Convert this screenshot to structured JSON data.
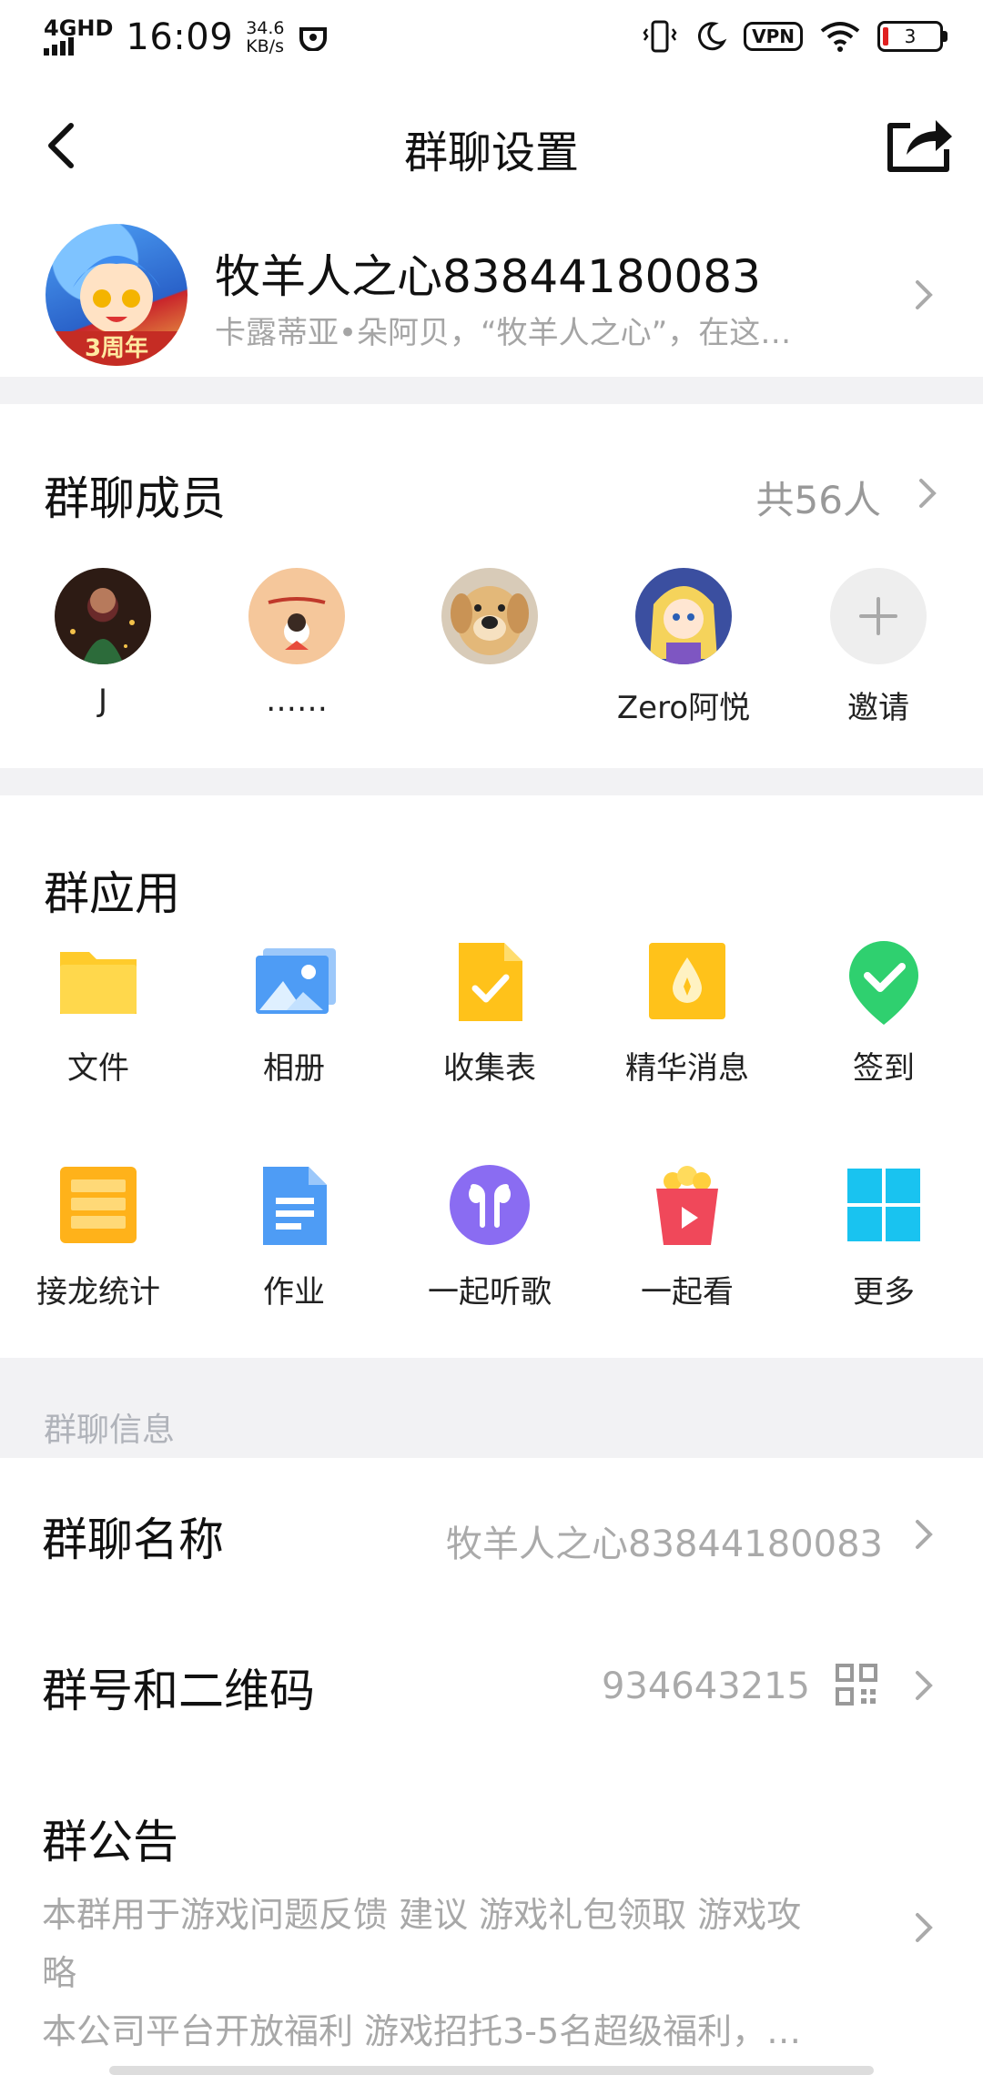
{
  "status_bar": {
    "network": "4GHD",
    "time": "16:09",
    "speed_value": "34.6",
    "speed_unit": "KB/s",
    "vpn": "VPN",
    "battery": "3"
  },
  "nav": {
    "title": "群聊设置",
    "back_icon": "chevron-left-icon",
    "share_icon": "share-icon"
  },
  "group": {
    "avatar_badge": "3周年",
    "name": "牧羊人之心83844180083",
    "description": "卡露蒂亚•朵阿贝，“牧羊人之心”，在这…"
  },
  "members": {
    "title": "群聊成员",
    "count": "共56人",
    "items": [
      {
        "name": "J"
      },
      {
        "name": "……"
      },
      {
        "name": ""
      },
      {
        "name": "Zero阿悦"
      },
      {
        "name": "邀请"
      }
    ]
  },
  "apps": {
    "title": "群应用",
    "items": [
      {
        "label": "文件",
        "icon": "folder-icon"
      },
      {
        "label": "相册",
        "icon": "photo-album-icon"
      },
      {
        "label": "收集表",
        "icon": "form-icon"
      },
      {
        "label": "精华消息",
        "icon": "essence-icon"
      },
      {
        "label": "签到",
        "icon": "check-in-icon"
      },
      {
        "label": "接龙统计",
        "icon": "solitaire-icon"
      },
      {
        "label": "作业",
        "icon": "homework-icon"
      },
      {
        "label": "一起听歌",
        "icon": "earphones-icon"
      },
      {
        "label": "一起看",
        "icon": "popcorn-video-icon"
      },
      {
        "label": "更多",
        "icon": "grid-more-icon"
      }
    ]
  },
  "info": {
    "section_title": "群聊信息",
    "group_name_label": "群聊名称",
    "group_name_value": "牧羊人之心83844180083",
    "group_number_label": "群号和二维码",
    "group_number_value": "934643215",
    "notice_label": "群公告",
    "notice_line1": "本群用于游戏问题反馈 建议 游戏礼包领取 游戏攻",
    "notice_line2": "略",
    "notice_line3": "本公司平台开放福利 游戏招托3-5名超级福利，…"
  },
  "colors": {
    "section_bg": "#f2f2f4",
    "secondary_text": "#a5a5a5",
    "folder_yellow": "#ffcb2b",
    "album_blue": "#4e9cf5",
    "checkin_green": "#2fd06f",
    "music_purple": "#8a6cf2",
    "watch_red": "#f0485a",
    "more_cyan": "#19c3f0"
  }
}
